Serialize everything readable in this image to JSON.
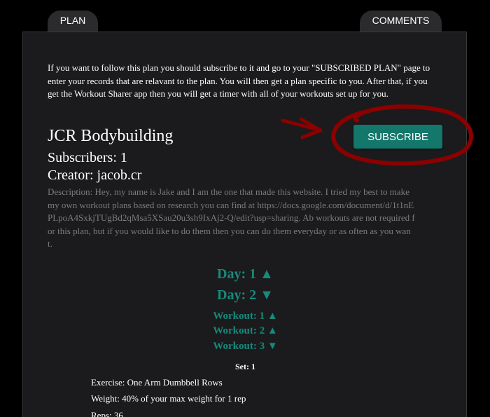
{
  "tabs": {
    "plan": "PLAN",
    "comments": "COMMENTS"
  },
  "intro_text": "If you want to follow this plan you should subscribe to it and go to your \"SUBSCRIBED PLAN\" page to enter your records that are relavant to the plan. You will then get a plan specific to you. After that, if you get the Workout Sharer app then you will get a timer with all of your workouts set up for you.",
  "plan": {
    "title": "JCR Bodybuilding",
    "subscribers": "Subscribers: 1",
    "creator": "Creator: jacob.cr",
    "description": "Description: Hey, my name is Jake and I am the one that made this website. I tried my best to make my own workout plans based on research you can find at https://docs.google.com/document/d/1t1nEPLpoA4SxkjTUgBd2qMsa5XSau20u3sh9IxAj2-Q/edit?usp=sharing. Ab workouts are not required for this plan, but if you would like to do them then you can do them everyday or as often as you want."
  },
  "subscribe_label": "SUBSCRIBE",
  "days": [
    {
      "label": "Day: 1 ▲"
    },
    {
      "label": "Day: 2 ▼"
    }
  ],
  "workouts": [
    {
      "label": "Workout: 1 ▲"
    },
    {
      "label": "Workout: 2 ▲"
    },
    {
      "label": "Workout: 3 ▼"
    }
  ],
  "set": {
    "label": "Set: 1",
    "exercise": "Exercise: One Arm Dumbbell Rows",
    "weight": "Weight: 40% of your max weight for 1 rep",
    "reps": "Reps: 36"
  },
  "colors": {
    "accent": "#13776b",
    "link": "#168a7c",
    "annotation": "#8b0000",
    "panel": "#1b1b1d",
    "tab": "#2b2b2d"
  }
}
